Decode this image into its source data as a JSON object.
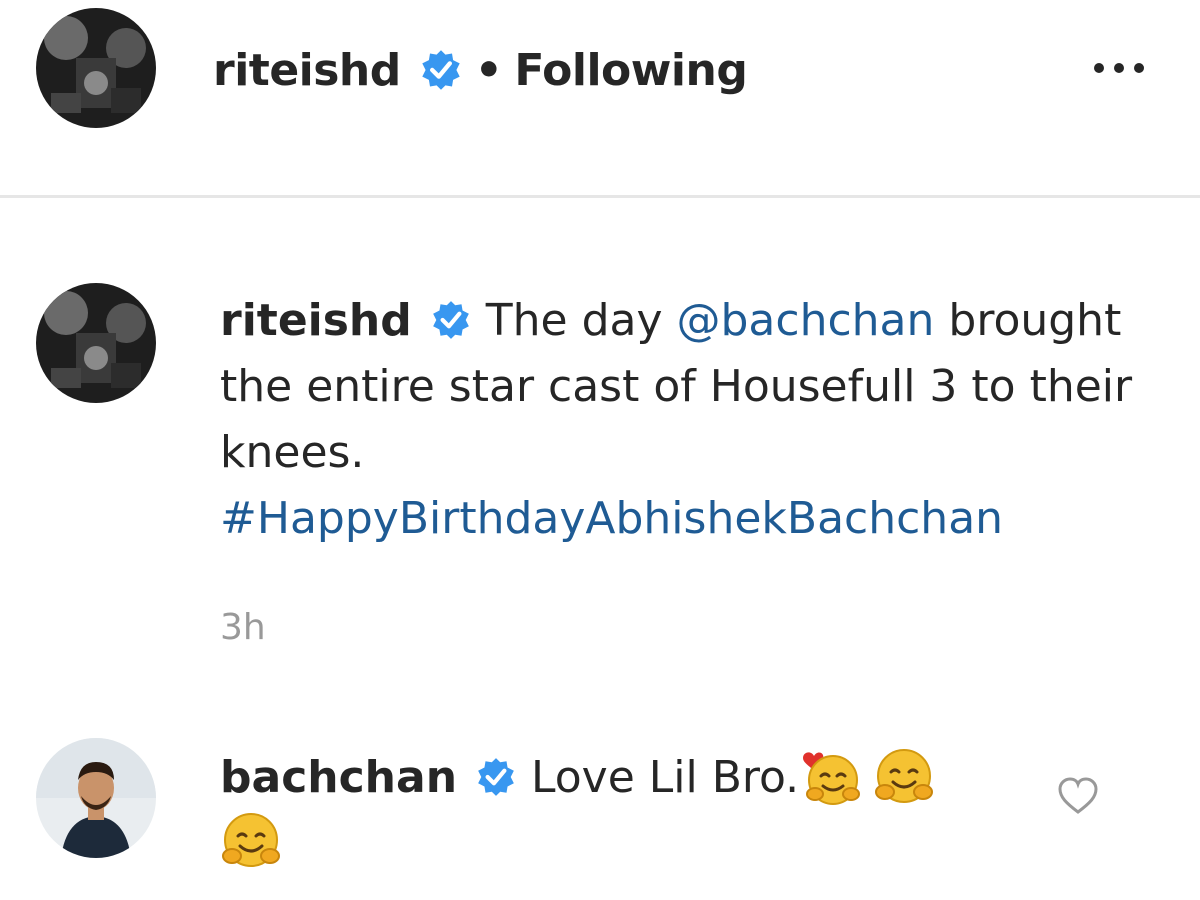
{
  "header": {
    "username": "riteishd",
    "separator": "•",
    "follow_status": "Following",
    "more_icon": "more-options-icon"
  },
  "post": {
    "username": "riteishd",
    "caption_part1": "The day ",
    "mention": "@bachchan",
    "caption_part2": " brought the entire star cast of Housefull 3 to their knees.",
    "hashtag": "#HappyBirthdayAbhishekBachchan",
    "time": "3h"
  },
  "comment": {
    "username": "bachchan",
    "text": "Love Lil Bro.",
    "emojis": [
      "heart-hug-emoji",
      "hugging-emoji",
      "hugging-emoji"
    ],
    "like_icon": "heart-outline-icon"
  },
  "colors": {
    "verified_blue": "#3897f0",
    "link_blue": "#1f5b94",
    "muted_gray": "#999999",
    "divider": "#e6e6e6"
  }
}
